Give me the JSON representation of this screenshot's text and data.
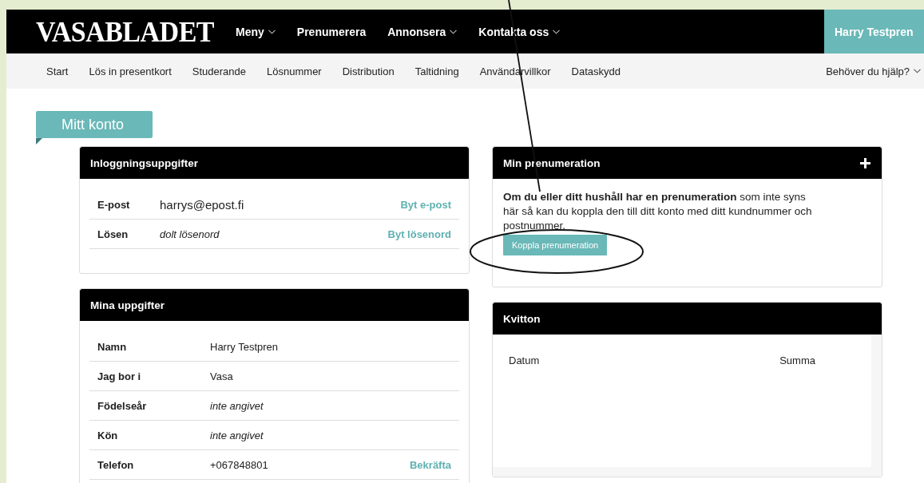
{
  "header": {
    "logo": "VASABLADET",
    "menu": [
      {
        "label": "Meny",
        "dropdown": true
      },
      {
        "label": "Prenumerera",
        "dropdown": false
      },
      {
        "label": "Annonsera",
        "dropdown": true
      },
      {
        "label": "Kontakta oss",
        "dropdown": true
      }
    ],
    "user": "Harry Testpren"
  },
  "subnav": {
    "items": [
      "Start",
      "Lös in presentkort",
      "Studerande",
      "Lösnummer",
      "Distribution",
      "Taltidning",
      "Användarvillkor",
      "Dataskydd"
    ],
    "help": {
      "label": "Behöver du hjälp?",
      "dropdown": true
    }
  },
  "page_title": "Mitt konto",
  "login_card": {
    "title": "Inloggningsuppgifter",
    "rows": [
      {
        "label": "E-post",
        "value": "harrys@epost.fi",
        "unset": false,
        "action": "Byt e-post"
      },
      {
        "label": "Lösen",
        "value": "dolt lösenord",
        "unset": true,
        "action": "Byt lösenord"
      }
    ]
  },
  "details_card": {
    "title": "Mina uppgifter",
    "rows": [
      {
        "label": "Namn",
        "value": "Harry Testpren",
        "unset": false
      },
      {
        "label": "Jag bor i",
        "value": "Vasa",
        "unset": false
      },
      {
        "label": "Födelseår",
        "value": "inte angivet",
        "unset": true
      },
      {
        "label": "Kön",
        "value": "inte angivet",
        "unset": true
      },
      {
        "label": "Telefon",
        "value": "+067848801",
        "unset": false,
        "action": "Bekräfta"
      }
    ]
  },
  "subscription_card": {
    "title": "Min prenumeration",
    "expandable": true,
    "text": "**Om du eller ditt hushåll har en prenumeration** som inte syns här så kan du koppla den till ditt konto med ditt kundnummer och postnummer.",
    "button": "Koppla prenumeration"
  },
  "receipts_card": {
    "title": "Kvitton",
    "columns": [
      "Datum",
      "Summa"
    ]
  },
  "annotation": {
    "kind": "ellipse-with-line"
  }
}
